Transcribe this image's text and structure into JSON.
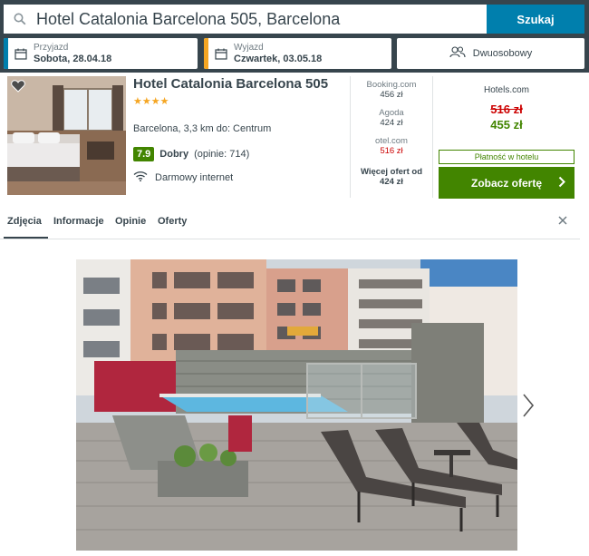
{
  "search": {
    "query": "Hotel Catalonia Barcelona 505, Barcelona",
    "button_label": "Szukaj"
  },
  "checkin": {
    "label": "Przyjazd",
    "value": "Sobota, 28.04.18"
  },
  "checkout": {
    "label": "Wyjazd",
    "value": "Czwartek, 03.05.18"
  },
  "room": {
    "label": "Dwuosobowy"
  },
  "hotel": {
    "name": "Hotel Catalonia Barcelona 505",
    "stars": "★★★★",
    "location": "Barcelona, 3,3 km do: Centrum",
    "score": "7.9",
    "rating_word": "Dobry",
    "rating_count": "(opinie: 714)",
    "amenity": "Darmowy internet"
  },
  "partners": [
    {
      "name": "Booking.com",
      "price": "456 zł",
      "highlight": false
    },
    {
      "name": "Agoda",
      "price": "424 zł",
      "highlight": false
    },
    {
      "name": "otel.com",
      "price": "516 zł",
      "highlight": true
    }
  ],
  "more_offers": {
    "label": "Więcej ofert od",
    "price": "424 zł"
  },
  "deal": {
    "site": "Hotels.com",
    "old_price": "516 zł",
    "new_price": "455 zł",
    "pay_badge": "Płatność w hotelu",
    "cta": "Zobacz ofertę"
  },
  "tabs": [
    {
      "label": "Zdjęcia",
      "active": true
    },
    {
      "label": "Informacje",
      "active": false
    },
    {
      "label": "Opinie",
      "active": false
    },
    {
      "label": "Oferty",
      "active": false
    }
  ],
  "colors": {
    "header_bg": "#37454d",
    "search_button": "#007fad",
    "checkin_stripe": "#007fad",
    "checkout_stripe": "#f5a623",
    "score_green": "#428500",
    "price_red": "#cc0000"
  }
}
